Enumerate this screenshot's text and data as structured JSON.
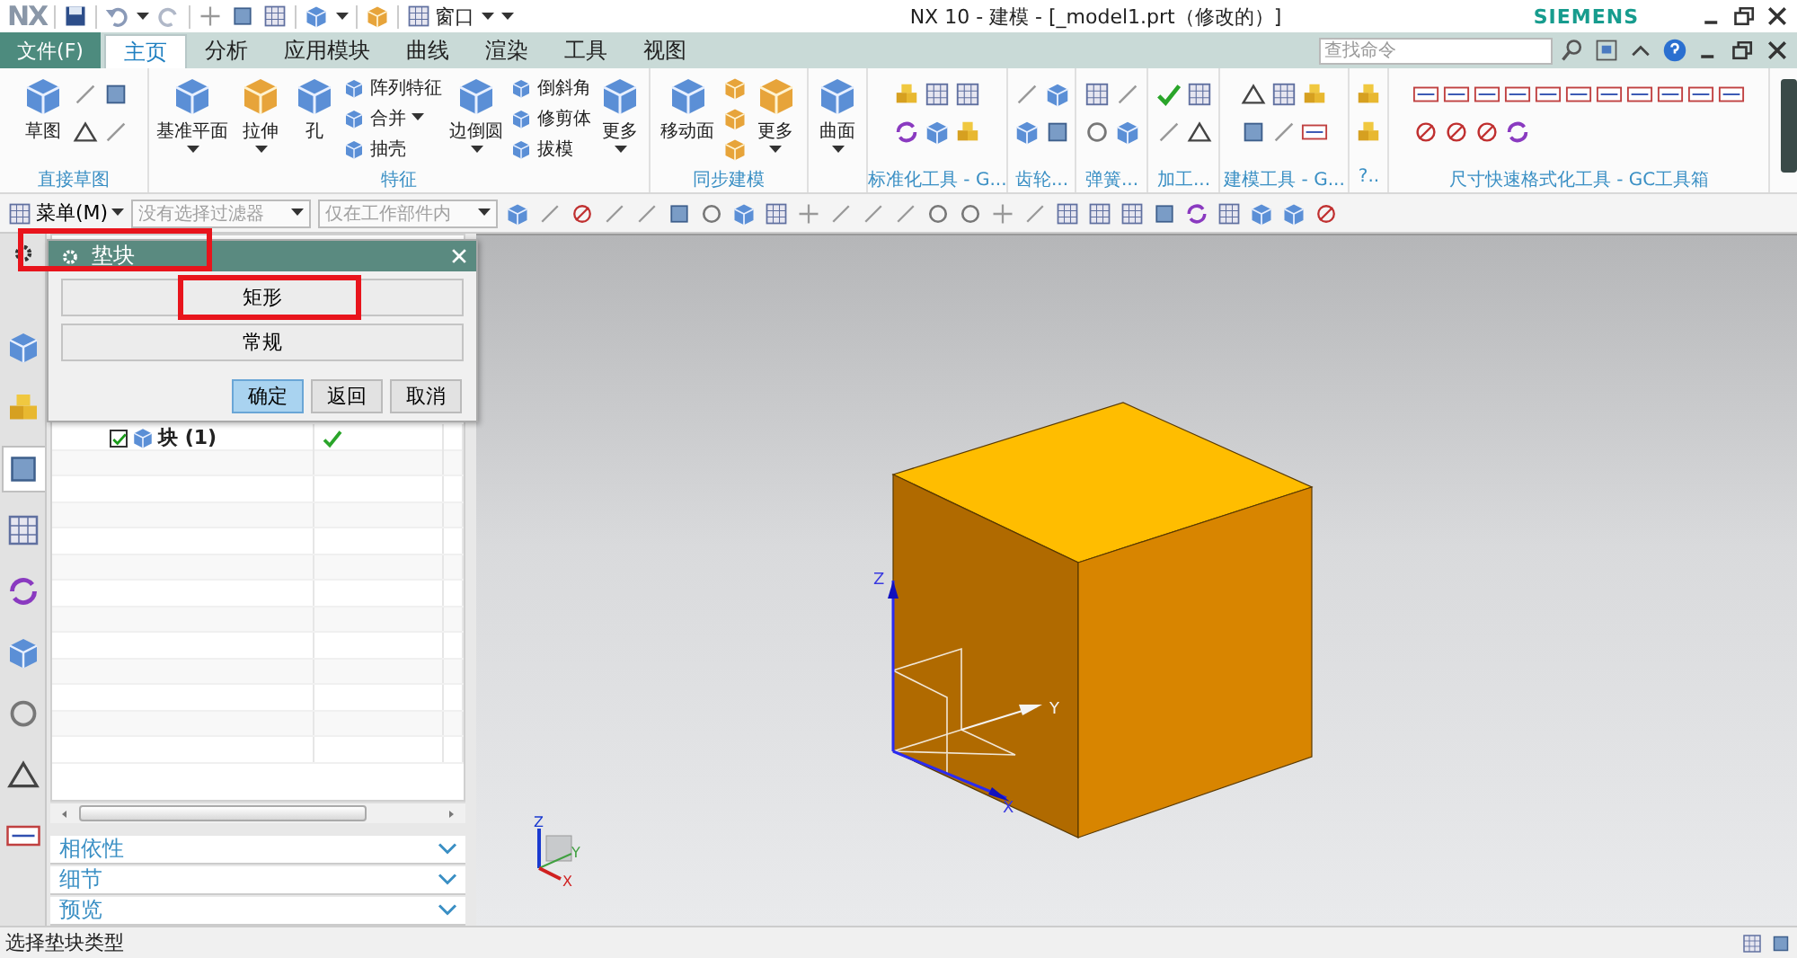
{
  "title_bar": {
    "logo": "NX",
    "window_menu": "窗口",
    "title": "NX 10 - 建模 - [_model1.prt（修改的）]",
    "brand": "SIEMENS"
  },
  "file_menu": "文件(F)",
  "tabs": [
    {
      "label": "主页",
      "selected": true
    },
    {
      "label": "分析",
      "selected": false
    },
    {
      "label": "应用模块",
      "selected": false
    },
    {
      "label": "曲线",
      "selected": false
    },
    {
      "label": "渲染",
      "selected": false
    },
    {
      "label": "工具",
      "selected": false
    },
    {
      "label": "视图",
      "selected": false
    }
  ],
  "search": {
    "placeholder": "查找命令"
  },
  "ribbon": [
    {
      "label": "直接草图",
      "buttons": [
        {
          "kind": "large",
          "label": "草图",
          "dropdown": false
        }
      ]
    },
    {
      "label": "特征",
      "buttons": [
        {
          "kind": "large",
          "label": "基准平面",
          "dropdown": true
        },
        {
          "kind": "large",
          "label": "拉伸",
          "dropdown": true
        },
        {
          "kind": "large",
          "label": "孔",
          "dropdown": false
        },
        {
          "kind": "stack",
          "items": [
            {
              "label": "阵列特征",
              "dropdown": false
            },
            {
              "label": "合并",
              "dropdown": true
            },
            {
              "label": "抽壳",
              "dropdown": false
            }
          ]
        },
        {
          "kind": "large",
          "label": "边倒圆",
          "dropdown": true
        },
        {
          "kind": "stack",
          "items": [
            {
              "label": "倒斜角",
              "dropdown": false
            },
            {
              "label": "修剪体",
              "dropdown": false
            },
            {
              "label": "拔模",
              "dropdown": false
            }
          ]
        },
        {
          "kind": "large",
          "label": "更多",
          "dropdown": true
        }
      ]
    },
    {
      "label": "同步建模",
      "buttons": [
        {
          "kind": "large",
          "label": "移动面",
          "dropdown": false
        },
        {
          "kind": "large",
          "label": "更多",
          "dropdown": true
        }
      ]
    },
    {
      "buttons": [
        {
          "kind": "large",
          "label": "曲面",
          "dropdown": true
        }
      ]
    },
    {
      "label": "标准化工具 - G..."
    },
    {
      "label": "齿轮..."
    },
    {
      "label": "弹簧..."
    },
    {
      "label": "加工..."
    },
    {
      "label": "建模工具 - G..."
    },
    {
      "label": "?.."
    },
    {
      "label": "尺寸快速格式化工具 - GC工具箱"
    }
  ],
  "toolbar": {
    "menu_button": "菜单(M)",
    "filters": [
      {
        "value": "没有选择过滤器",
        "disabled": true
      },
      {
        "value": "仅在工作部件内",
        "disabled": true
      }
    ]
  },
  "resource_tabs": [
    {
      "selected": false
    },
    {
      "selected": false
    },
    {
      "selected": true
    },
    {
      "selected": false
    },
    {
      "selected": false
    },
    {
      "selected": false
    },
    {
      "selected": false
    },
    {
      "selected": false
    },
    {
      "selected": false
    }
  ],
  "navigator": {
    "rows": [
      {
        "label": "块 (1)",
        "checked": true,
        "status_ok": true
      }
    ],
    "sections": [
      {
        "label": "相依性",
        "expanded": false
      },
      {
        "label": "细节",
        "expanded": false
      },
      {
        "label": "预览",
        "expanded": false
      }
    ]
  },
  "dialog": {
    "title": "垫块",
    "title_highlighted": true,
    "types": [
      {
        "label": "矩形",
        "highlighted": true
      },
      {
        "label": "常规",
        "highlighted": false
      }
    ],
    "actions": [
      {
        "label": "确定",
        "default": true
      },
      {
        "label": "返回",
        "default": false
      },
      {
        "label": "取消",
        "default": false
      }
    ]
  },
  "viewport": {
    "axis_labels": {
      "z": "Z",
      "y": "Y",
      "x": "X"
    },
    "triad_labels": {
      "z": "Z",
      "y": "Y",
      "x": "X"
    }
  },
  "status_bar": {
    "prompt": "选择垫块类型"
  }
}
